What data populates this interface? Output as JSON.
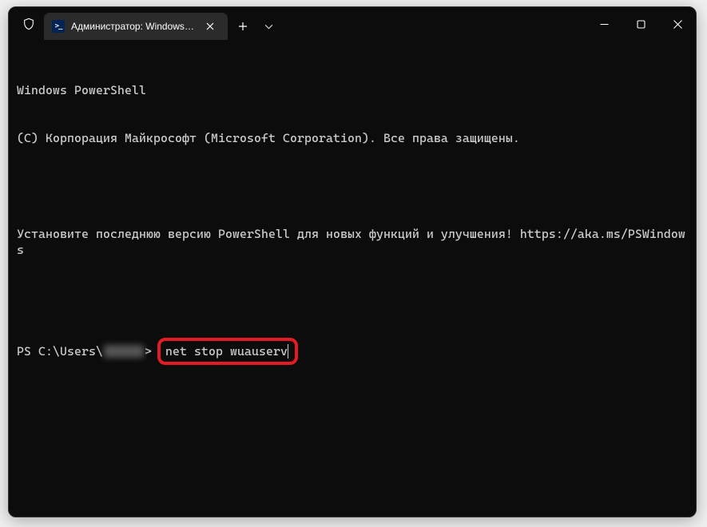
{
  "window": {
    "tab_title": "Администратор: Windows Pc",
    "icons": {
      "shield": "shield-icon",
      "powershell": "powershell-icon",
      "close_tab": "close-tab-icon",
      "new_tab": "plus-icon",
      "dropdown": "chevron-down-icon",
      "minimize": "minimize-icon",
      "maximize": "maximize-icon",
      "close_win": "close-icon"
    }
  },
  "terminal": {
    "line1": "Windows PowerShell",
    "line2": "(C) Корпорация Майкрософт (Microsoft Corporation). Все права защищены.",
    "line3": "Установите последнюю версию PowerShell для новых функций и улучшения! https://aka.ms/PSWindows",
    "prompt_prefix": "PS C:\\Users\\",
    "prompt_suffix": "> ",
    "command": "net stop wuauserv"
  },
  "colors": {
    "highlight_border": "#e41b23",
    "text": "#cccccc",
    "bg": "#0c0c0c"
  }
}
